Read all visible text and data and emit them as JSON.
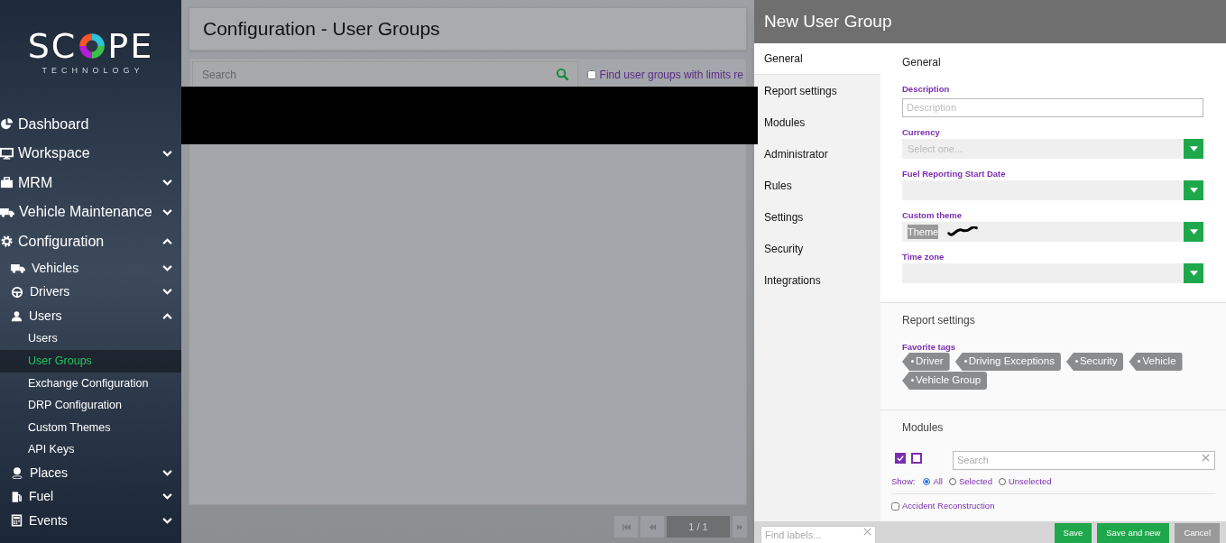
{
  "sidebar": {
    "logo": {
      "left": "SC",
      "right": "PE",
      "subtitle": "TECHNOLOGY"
    },
    "items": [
      {
        "label": "Dashboard"
      },
      {
        "label": "Workspace",
        "expanded": false
      },
      {
        "label": "MRM",
        "expanded": false
      },
      {
        "label": "Vehicle Maintenance",
        "expanded": false
      },
      {
        "label": "Configuration",
        "expanded": true,
        "children": [
          {
            "label": "Vehicles",
            "expanded": false
          },
          {
            "label": "Drivers",
            "expanded": false
          },
          {
            "label": "Users",
            "expanded": true,
            "children": [
              {
                "label": "Users",
                "selected": false
              },
              {
                "label": "User Groups",
                "selected": true
              },
              {
                "label": "Exchange Configuration",
                "selected": false
              },
              {
                "label": "DRP Configuration",
                "selected": false
              },
              {
                "label": "Custom Themes",
                "selected": false
              },
              {
                "label": "API Keys",
                "selected": false
              }
            ]
          },
          {
            "label": "Places",
            "expanded": false
          },
          {
            "label": "Fuel",
            "expanded": false
          },
          {
            "label": "Events",
            "expanded": false
          }
        ]
      }
    ]
  },
  "main": {
    "title": "Configuration - User Groups",
    "search": {
      "placeholder": "Search"
    },
    "limits_filter": {
      "label": "Find user groups with limits re",
      "checked": false
    },
    "pagination": {
      "page": "1 / 1"
    }
  },
  "panel": {
    "title": "New User Group",
    "tabs": [
      {
        "label": "General",
        "selected": true
      },
      {
        "label": "Report settings",
        "selected": false
      },
      {
        "label": "Modules",
        "selected": false
      },
      {
        "label": "Administrator",
        "selected": false
      },
      {
        "label": "Rules",
        "selected": false
      },
      {
        "label": "Settings",
        "selected": false
      },
      {
        "label": "Security",
        "selected": false
      },
      {
        "label": "Integrations",
        "selected": false
      }
    ],
    "general": {
      "heading": "General",
      "fields": [
        {
          "label": "Description",
          "kind": "text",
          "placeholder": "Description"
        },
        {
          "label": "Currency",
          "kind": "select",
          "placeholder": "Select one..."
        },
        {
          "label": "Fuel Reporting Start Date",
          "kind": "select"
        },
        {
          "label": "Custom theme",
          "kind": "select",
          "value": "Theme"
        },
        {
          "label": "Time zone",
          "kind": "select"
        }
      ]
    },
    "report_settings": {
      "heading": "Report settings",
      "tags_label": "Favorite tags",
      "tags": [
        "Driver",
        "Driving Exceptions",
        "Security",
        "Vehicle",
        "Vehicle Group"
      ]
    },
    "modules": {
      "heading": "Modules",
      "select_all_checked": true,
      "select_none_checked": false,
      "search": {
        "placeholder": "Search"
      },
      "show_label": "Show:",
      "show_options": [
        {
          "label": "All",
          "selected": true
        },
        {
          "label": "Selected",
          "selected": false
        },
        {
          "label": "Unselected",
          "selected": false
        }
      ],
      "items": [
        {
          "label": "Accident Reconstruction",
          "checked": false
        }
      ]
    },
    "footer": {
      "find_labels": {
        "placeholder": "Find labels..."
      },
      "buttons": [
        {
          "label": "Save",
          "kind": "primary"
        },
        {
          "label": "Save and new",
          "kind": "primary"
        },
        {
          "label": "Cancel",
          "kind": "secondary"
        }
      ]
    }
  }
}
